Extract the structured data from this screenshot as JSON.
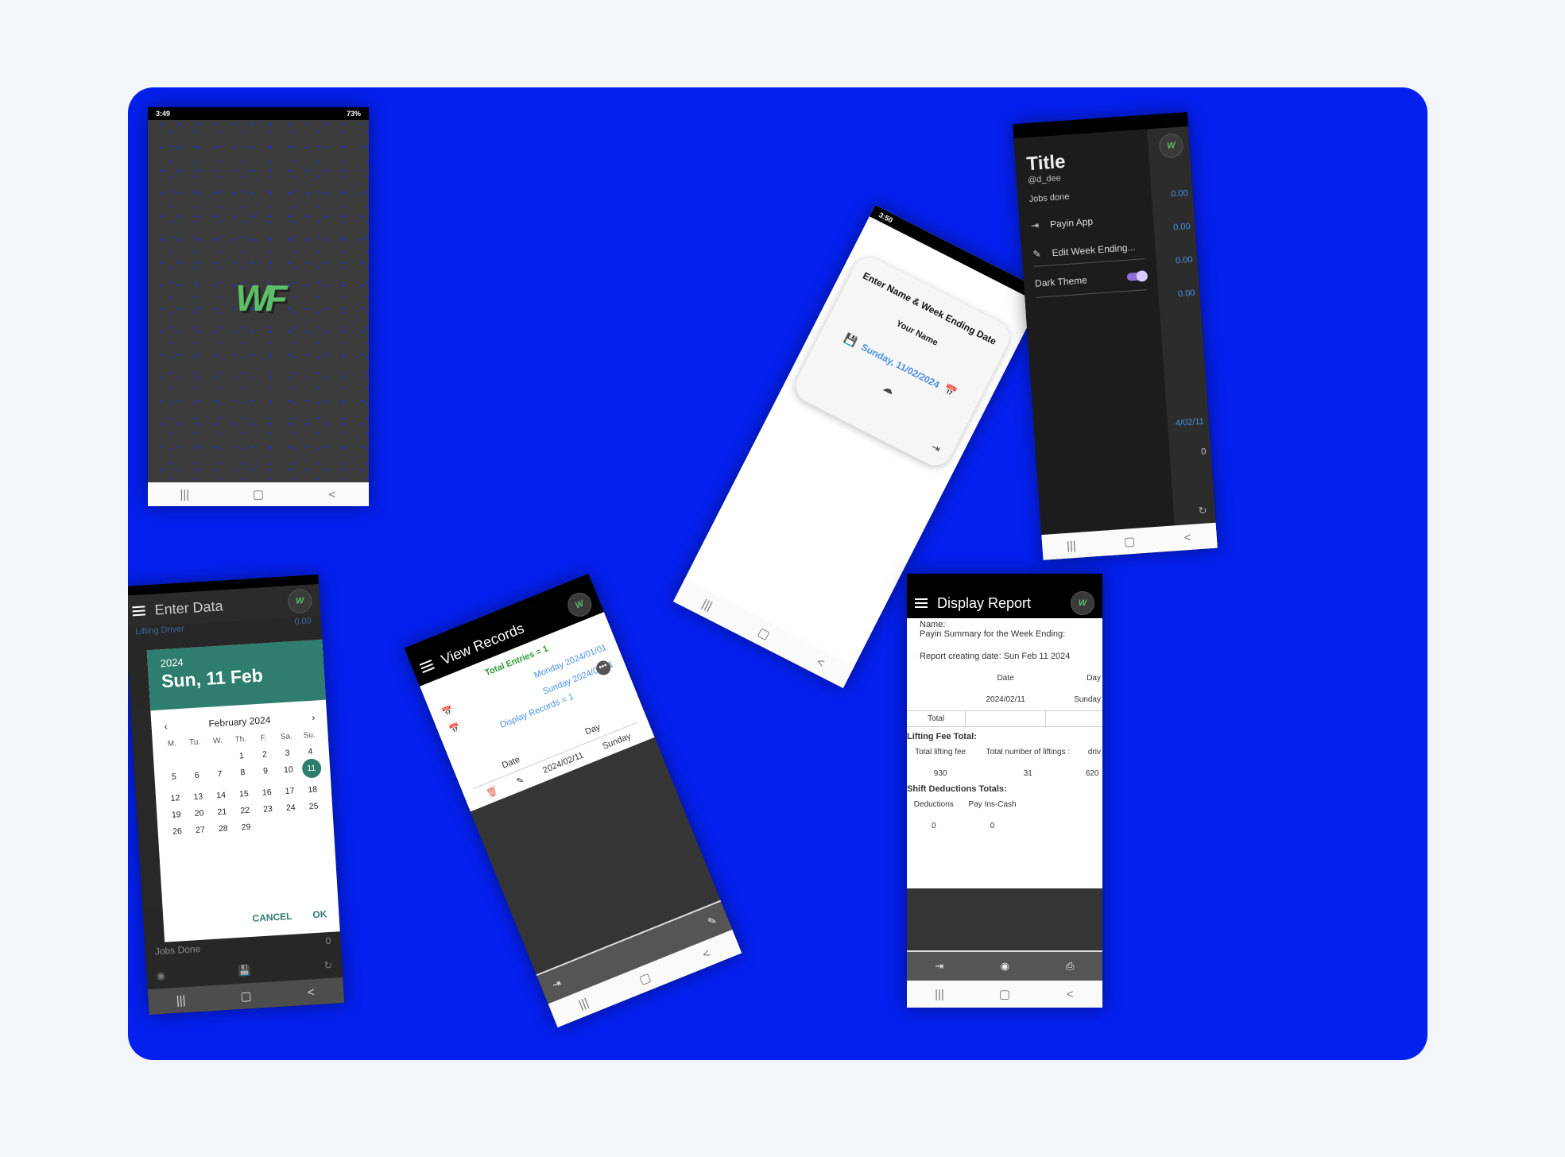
{
  "splash": {
    "time": "3:49",
    "battery": "73%",
    "logo_text": "WF",
    "nav": [
      "|||",
      "▢",
      "<"
    ]
  },
  "weekend_dialog": {
    "time": "3:50",
    "title": "Enter Name & Week Ending Date",
    "name_label": "Your Name",
    "date_value": "Sunday, 11/02/2024",
    "nav": [
      "|||",
      "▢",
      "<"
    ]
  },
  "drawer": {
    "title": "Title",
    "handle": "@d_dee",
    "jobs_label": "Jobs done",
    "items": [
      {
        "label": "Payin App"
      },
      {
        "label": "Edit Week Ending..."
      }
    ],
    "dark_theme_label": "Dark Theme",
    "side_values": [
      "0.00",
      "0.00",
      "0.00",
      "0.00"
    ],
    "side_date": "4/02/11",
    "side_zero": "0",
    "nav": [
      "|||",
      "▢",
      "<"
    ]
  },
  "enter_data": {
    "app_title": "Enter Data",
    "peek_label": "Lifting Driver",
    "peek_value": "0.00",
    "jobs_done_label": "Jobs Done",
    "jobs_done_value": "0",
    "datepicker": {
      "year": "2024",
      "date_heading": "Sun, 11 Feb",
      "month_label": "February 2024",
      "weekdays": [
        "M.",
        "Tu.",
        "W.",
        "Th.",
        "F.",
        "Sa.",
        "Su."
      ],
      "days": [
        "",
        "",
        "",
        "1",
        "2",
        "3",
        "4",
        "5",
        "6",
        "7",
        "8",
        "9",
        "10",
        "11",
        "12",
        "13",
        "14",
        "15",
        "16",
        "17",
        "18",
        "19",
        "20",
        "21",
        "22",
        "23",
        "24",
        "25",
        "26",
        "27",
        "28",
        "29"
      ],
      "selected": "11",
      "cancel_label": "CANCEL",
      "ok_label": "OK"
    },
    "nav": [
      "|||",
      "▢",
      "<"
    ]
  },
  "view_records": {
    "app_title": "View Records",
    "total_entries": "Total Entries = 1",
    "record1": "Monday 2024/01/01",
    "record2": "Sunday 2024/02/11",
    "display_records": "Display Records = 1",
    "col_date": "Date",
    "col_day": "Day",
    "row_date": "2024/02/11",
    "row_day": "Sunday",
    "nav": [
      "|||",
      "▢",
      "<"
    ]
  },
  "display_report": {
    "app_title": "Display Report",
    "name_line": "Name:",
    "summary_line": "Payin Summary for the Week Ending:",
    "creating_date": "Report creating date: Sun Feb 11 2024",
    "col_date": "Date",
    "col_day": "Day",
    "row_date": "2024/02/11",
    "row_day": "Sunday",
    "total_label": "Total",
    "lifting_title": "Lifting Fee Total:",
    "lift_headers": [
      "Total lifting fee",
      "Total number of liftings :",
      "driv"
    ],
    "lift_values": [
      "930",
      "31",
      "620"
    ],
    "shift_title": "Shift Deductions Totals:",
    "shift_headers": [
      "Deductions",
      "Pay Ins-Cash"
    ],
    "shift_values": [
      "0",
      "0"
    ],
    "nav": [
      "|||",
      "▢",
      "<"
    ]
  },
  "colors": {
    "stage": "#0420ee",
    "teal": "#2e7d6f",
    "accent_blue": "#4a90e2",
    "green_text": "#2e9a3a"
  }
}
